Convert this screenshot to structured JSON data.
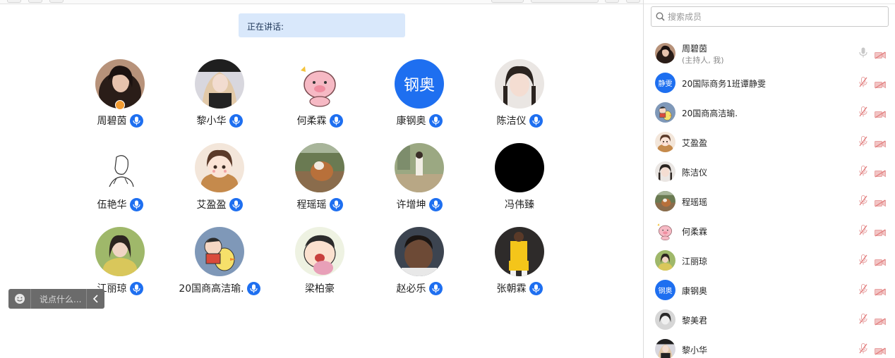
{
  "speaking": {
    "label": "正在讲话:"
  },
  "colors": {
    "accent": "#1e6ff0",
    "speaking_bg": "#d9e8fb",
    "host_badge": "#f39c32",
    "muted_red": "#e27b7b"
  },
  "grid": [
    {
      "name": "周碧茵",
      "avatar": "photo-woman-dark-hair",
      "mic": true,
      "host": true
    },
    {
      "name": "黎小华",
      "avatar": "photo-woman-light-hair",
      "mic": true
    },
    {
      "name": "何柔霖",
      "avatar": "cartoon-pig",
      "mic": true
    },
    {
      "name": "康钢奥",
      "avatar_text": "钢奥",
      "mic": true
    },
    {
      "name": "陈洁仪",
      "avatar": "photo-girl-braids",
      "mic": true
    },
    {
      "name": "伍艳华",
      "avatar": "sketch-drawing",
      "mic": true
    },
    {
      "name": "艾盈盈",
      "avatar": "cartoon-girl-bear",
      "mic": true
    },
    {
      "name": "程瑶瑶",
      "avatar": "photo-animal",
      "mic": true
    },
    {
      "name": "许增坤",
      "avatar": "photo-outdoor",
      "mic": true
    },
    {
      "name": "冯伟臻",
      "avatar": "black-image",
      "mic": false
    },
    {
      "name": "江丽琼",
      "avatar": "photo-girl-green",
      "mic": true
    },
    {
      "name": "20国商高洁瑜.",
      "avatar": "cartoon-bird",
      "mic": true
    },
    {
      "name": "梁柏豪",
      "avatar": "cartoon-shinchan",
      "mic": false
    },
    {
      "name": "赵必乐",
      "avatar": "photo-man-dark",
      "mic": true
    },
    {
      "name": "张朝霖",
      "avatar": "photo-basketball",
      "mic": true
    }
  ],
  "chat": {
    "placeholder": "说点什么..."
  },
  "search": {
    "placeholder": "搜索成员"
  },
  "members": [
    {
      "name": "周碧茵",
      "sub": "(主持人, 我)",
      "avatar": "photo-woman-dark-hair",
      "mic_state": "available"
    },
    {
      "name": "20国际商务1班谭静雯",
      "avatar_text": "静雯",
      "mic_state": "muted"
    },
    {
      "name": "20国商高洁瑜.",
      "avatar": "cartoon-bird",
      "mic_state": "muted"
    },
    {
      "name": "艾盈盈",
      "avatar": "cartoon-girl-bear",
      "mic_state": "muted"
    },
    {
      "name": "陈洁仪",
      "avatar": "photo-girl-braids",
      "mic_state": "muted"
    },
    {
      "name": "程瑶瑶",
      "avatar": "photo-animal",
      "mic_state": "muted"
    },
    {
      "name": "何柔霖",
      "avatar": "cartoon-pig",
      "mic_state": "muted"
    },
    {
      "name": "江丽琼",
      "avatar": "photo-girl-green",
      "mic_state": "muted"
    },
    {
      "name": "康钢奥",
      "avatar_text": "钢奥",
      "mic_state": "muted"
    },
    {
      "name": "黎美君",
      "avatar": "photo-woman-bw",
      "mic_state": "muted"
    },
    {
      "name": "黎小华",
      "avatar": "photo-woman-light-hair",
      "mic_state": "muted"
    }
  ]
}
